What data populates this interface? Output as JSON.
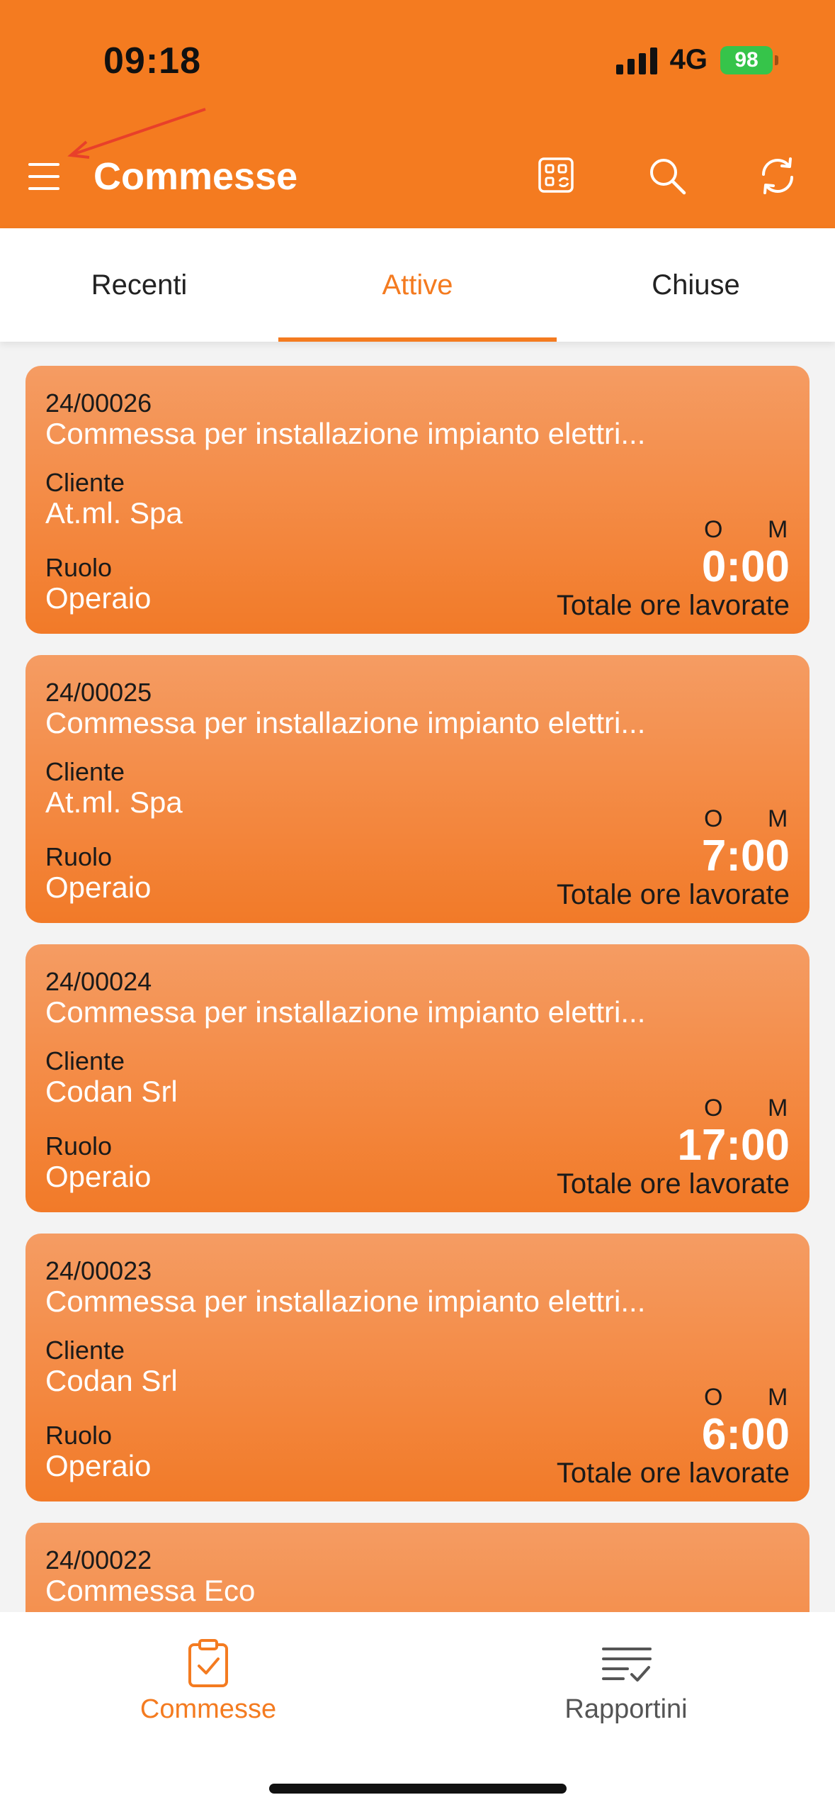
{
  "status_bar": {
    "time": "09:18",
    "network": "4G",
    "battery": "98"
  },
  "header": {
    "title": "Commesse",
    "icons": [
      "menu-icon",
      "qr-sync-icon",
      "search-icon",
      "refresh-icon"
    ],
    "annotation": "red-arrow-pointing-to-menu"
  },
  "tabs": [
    {
      "label": "Recenti",
      "active": false
    },
    {
      "label": "Attive",
      "active": true
    },
    {
      "label": "Chiuse",
      "active": false
    }
  ],
  "cards": [
    {
      "code": "24/00026",
      "description": "Commessa per installazione impianto elettri...",
      "client_label": "Cliente",
      "client": "At.ml. Spa",
      "role_label": "Ruolo",
      "role": "Operaio",
      "o_label": "O",
      "m_label": "M",
      "hours": "0:00",
      "hours_label": "Totale ore lavorate"
    },
    {
      "code": "24/00025",
      "description": "Commessa per installazione impianto elettri...",
      "client_label": "Cliente",
      "client": "At.ml. Spa",
      "role_label": "Ruolo",
      "role": "Operaio",
      "o_label": "O",
      "m_label": "M",
      "hours": "7:00",
      "hours_label": "Totale ore lavorate"
    },
    {
      "code": "24/00024",
      "description": "Commessa per installazione impianto elettri...",
      "client_label": "Cliente",
      "client": "Codan Srl",
      "role_label": "Ruolo",
      "role": "Operaio",
      "o_label": "O",
      "m_label": "M",
      "hours": "17:00",
      "hours_label": "Totale ore lavorate"
    },
    {
      "code": "24/00023",
      "description": "Commessa per installazione impianto elettri...",
      "client_label": "Cliente",
      "client": "Codan Srl",
      "role_label": "Ruolo",
      "role": "Operaio",
      "o_label": "O",
      "m_label": "M",
      "hours": "6:00",
      "hours_label": "Totale ore lavorate"
    },
    {
      "code": "24/00022",
      "description": "Commessa Eco"
    }
  ],
  "bottom_nav": [
    {
      "label": "Commesse",
      "icon": "clipboard-check-icon",
      "active": true
    },
    {
      "label": "Rapportini",
      "icon": "list-check-icon",
      "active": false
    }
  ],
  "colors": {
    "accent": "#f47b20",
    "card_top": "#f59c63",
    "card_bottom": "#f27a28",
    "inactive": "#555555"
  }
}
